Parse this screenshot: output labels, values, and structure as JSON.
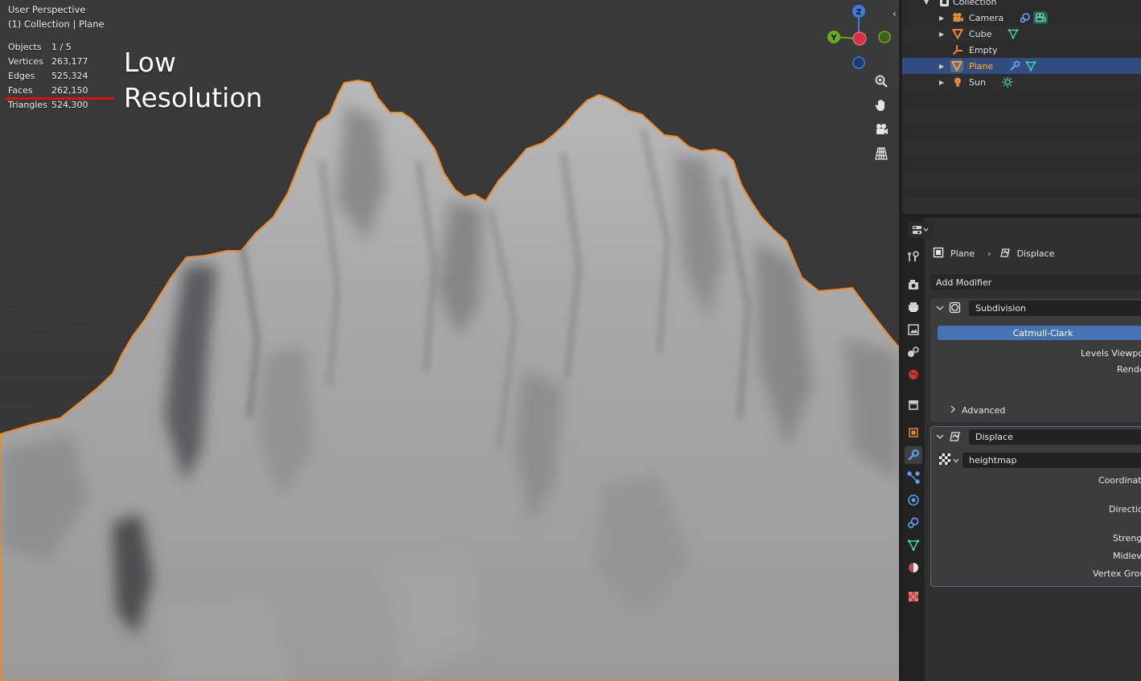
{
  "viewport": {
    "view_name": "User Perspective",
    "context": "(1) Collection | Plane",
    "stats": [
      {
        "key": "Objects",
        "value": "1 / 5"
      },
      {
        "key": "Vertices",
        "value": "263,177"
      },
      {
        "key": "Edges",
        "value": "525,324"
      },
      {
        "key": "Faces",
        "value": "262,150"
      },
      {
        "key": "Triangles",
        "value": "524,300"
      }
    ],
    "annotation_line1": "Low",
    "annotation_line2": "Resolution",
    "gizmo": {
      "z": "Z",
      "y": "Y"
    },
    "colors": {
      "selection_outline": "#f08a24",
      "annotation_underline": "#e01010",
      "x_axis": "#d6304a",
      "y_axis": "#6ea91b",
      "z_axis": "#3d7ee0"
    }
  },
  "outliner": {
    "rows": [
      {
        "label": "Collection",
        "icon": "collection-icon"
      },
      {
        "label": "Camera",
        "icon": "camera-icon"
      },
      {
        "label": "Cube",
        "icon": "mesh-icon"
      },
      {
        "label": "Empty",
        "icon": "empty-icon"
      },
      {
        "label": "Plane",
        "icon": "mesh-icon",
        "selected": true
      },
      {
        "label": "Sun",
        "icon": "light-icon"
      }
    ]
  },
  "properties": {
    "breadcrumb_object": "Plane",
    "breadcrumb_modifier": "Displace",
    "add_modifier": "Add Modifier",
    "subdivision": {
      "name": "Subdivision",
      "method": "Catmull-Clark",
      "levels_viewport_label": "Levels Viewpor",
      "render_label": "Rende",
      "advanced_label": "Advanced"
    },
    "displace": {
      "name": "Displace",
      "texture": "heightmap",
      "coordinates_label": "Coordinate",
      "direction_label": "Directio",
      "strength_label": "Strengt",
      "midlevel_label": "Midleve",
      "vertex_group_label": "Vertex Grou"
    }
  }
}
